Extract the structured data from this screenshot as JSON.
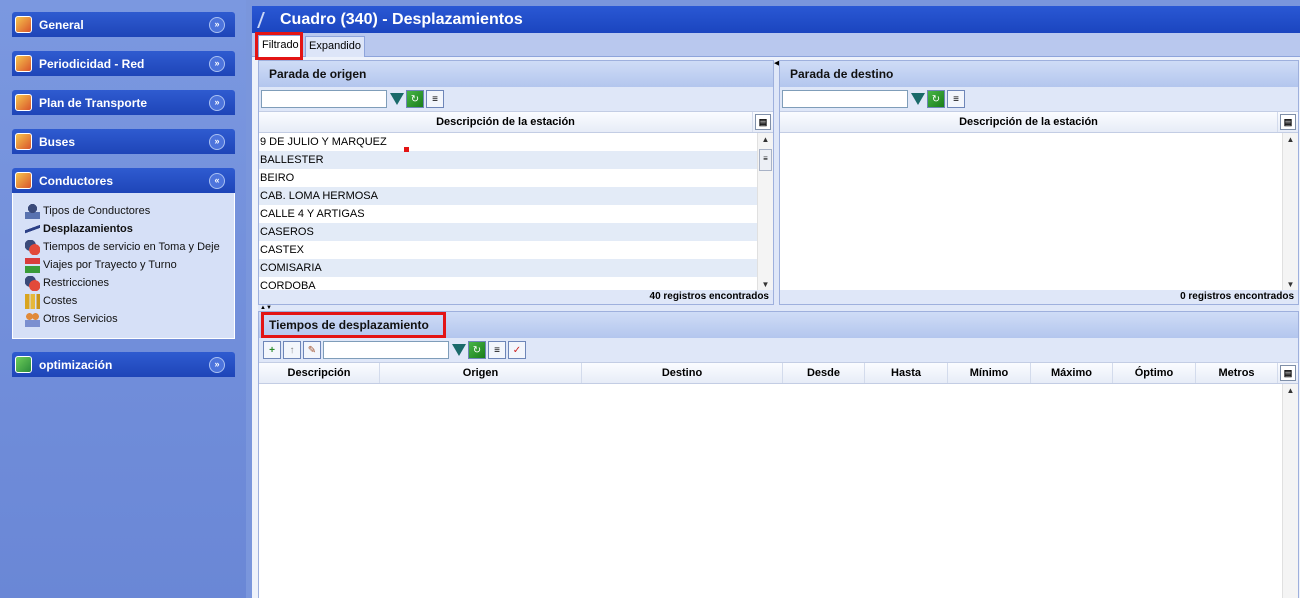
{
  "nav": {
    "groups": [
      {
        "label": "General",
        "icon": "general-icon",
        "expanded": false
      },
      {
        "label": "Periodicidad - Red",
        "icon": "periodicidad-icon",
        "expanded": false
      },
      {
        "label": "Plan de Transporte",
        "icon": "plan-icon",
        "expanded": false
      },
      {
        "label": "Buses",
        "icon": "bus-icon",
        "expanded": false
      },
      {
        "label": "Conductores",
        "icon": "conductores-icon",
        "expanded": true,
        "items": [
          {
            "label": "Tipos de Conductores",
            "icon": "driver-type-icon"
          },
          {
            "label": "Desplazamientos",
            "icon": "walking-icon",
            "active": true
          },
          {
            "label": "Tiempos de servicio en Toma y Deje",
            "icon": "service-time-icon"
          },
          {
            "label": "Viajes por Trayecto y Turno",
            "icon": "trips-icon"
          },
          {
            "label": "Restricciones",
            "icon": "restriction-icon"
          },
          {
            "label": "Costes",
            "icon": "coins-icon"
          },
          {
            "label": "Otros Servicios",
            "icon": "services-icon"
          }
        ]
      },
      {
        "label": "optimización",
        "icon": "optimizacion-icon",
        "expanded": false
      }
    ]
  },
  "window": {
    "title": "Cuadro (340) - Desplazamientos"
  },
  "tabs": [
    {
      "label": "Filtrado",
      "selected": true
    },
    {
      "label": "Expandido",
      "selected": false
    }
  ],
  "origin": {
    "title": "Parada de origen",
    "column": "Descripción de la estación",
    "rows": [
      "9 DE JULIO Y MARQUEZ",
      "BALLESTER",
      "BEIRO",
      "CAB. LOMA HERMOSA",
      "CALLE 4 Y ARTIGAS",
      "CASEROS",
      "CASTEX",
      "COMISARIA",
      "CORDOBA"
    ],
    "status": "40 registros encontrados"
  },
  "destination": {
    "title": "Parada de destino",
    "column": "Descripción de la estación",
    "status": "0 registros encontrados"
  },
  "times": {
    "title": "Tiempos de desplazamiento",
    "columns": [
      "Descripción",
      "Origen",
      "Destino",
      "Desde",
      "Hasta",
      "Mínimo",
      "Máximo",
      "Óptimo",
      "Metros"
    ]
  },
  "colors": {
    "accent": "#1e45b8",
    "highlight": "#e31414"
  }
}
